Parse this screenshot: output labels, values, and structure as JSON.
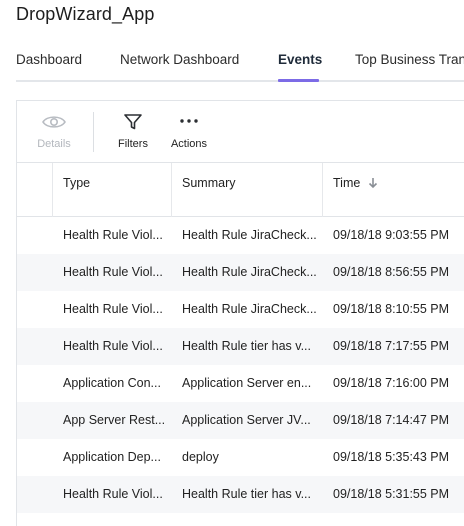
{
  "app": {
    "title": "DropWizard_App"
  },
  "tabs": [
    {
      "label": "Dashboard",
      "active": false
    },
    {
      "label": "Network Dashboard",
      "active": false
    },
    {
      "label": "Events",
      "active": true
    },
    {
      "label": "Top Business Tran",
      "active": false
    }
  ],
  "toolbar": {
    "details_label": "Details",
    "filters_label": "Filters",
    "actions_label": "Actions"
  },
  "table": {
    "columns": {
      "type": "Type",
      "summary": "Summary",
      "time": "Time"
    },
    "rows": [
      {
        "severity": "error",
        "type": "Health Rule Viol...",
        "summary": "Health Rule JiraCheck...",
        "time": "09/18/18 9:03:55 PM"
      },
      {
        "severity": "error",
        "type": "Health Rule Viol...",
        "summary": "Health Rule JiraCheck...",
        "time": "09/18/18 8:56:55 PM"
      },
      {
        "severity": "error",
        "type": "Health Rule Viol...",
        "summary": "Health Rule JiraCheck...",
        "time": "09/18/18 8:10:55 PM"
      },
      {
        "severity": "error",
        "type": "Health Rule Viol...",
        "summary": "Health Rule tier has v...",
        "time": "09/18/18 7:17:55 PM"
      },
      {
        "severity": "info",
        "type": "Application Con...",
        "summary": "Application Server en...",
        "time": "09/18/18 7:16:00 PM"
      },
      {
        "severity": "info",
        "type": "App Server Rest...",
        "summary": "Application Server JV...",
        "time": "09/18/18 7:14:47 PM"
      },
      {
        "severity": "info",
        "type": "Application Dep...",
        "summary": "deploy",
        "time": "09/18/18 5:35:43 PM"
      },
      {
        "severity": "error",
        "type": "Health Rule Viol...",
        "summary": "Health Rule tier has v...",
        "time": "09/18/18 5:31:55 PM"
      }
    ]
  },
  "colors": {
    "accent": "#7c6be6",
    "error": "#d92d2d",
    "info": "#1f6fe0"
  },
  "icons": {
    "details": "eye-icon",
    "filters": "funnel-icon",
    "actions": "ellipsis-icon",
    "sort": "arrow-down-icon"
  }
}
